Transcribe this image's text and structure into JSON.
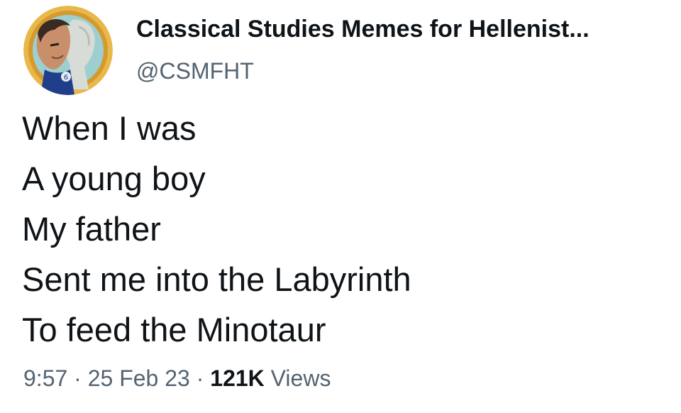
{
  "author": {
    "display_name": "Classical Studies Memes for Hellenist...",
    "handle": "@CSMFHT",
    "avatar_icon": "profile-avatar-marble-bust-icon"
  },
  "tweet": {
    "lines": [
      "When I was",
      "A young boy",
      "My father",
      "Sent me into the Labyrinth",
      "To feed the Minotaur"
    ],
    "time": "9:57",
    "separator": "·",
    "date": "25 Feb 23",
    "views_count": "121K",
    "views_label": "Views"
  },
  "colors": {
    "text_primary": "#0f1419",
    "text_secondary": "#536471",
    "background": "#ffffff"
  }
}
